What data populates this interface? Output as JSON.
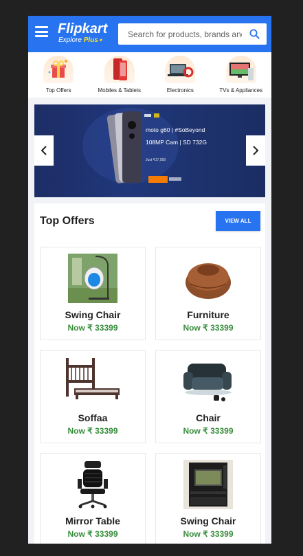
{
  "header": {
    "brand": "Flipkart",
    "tagline_prefix": "Explore",
    "tagline_plus": "Plus",
    "search_placeholder": "Search for products, brands and more"
  },
  "categories": [
    {
      "label": "Top Offers",
      "icon": "gift-icon"
    },
    {
      "label": "Mobiles & Tablets",
      "icon": "phone-icon"
    },
    {
      "label": "Electronics",
      "icon": "laptop-icon"
    },
    {
      "label": "TVs & Appliances",
      "icon": "tv-icon"
    }
  ],
  "banner": {
    "line1": "moto g60 | #SoBeyond",
    "line2": "108MP Cam | SD 732G",
    "line3": "Just ₹17,999"
  },
  "offers": {
    "title": "Top Offers",
    "view_all": "VIEW ALL",
    "products": [
      {
        "name": "Swing Chair",
        "price": "Now ₹ 33399",
        "icon": "swing-chair-icon"
      },
      {
        "name": "Furniture",
        "price": "Now ₹ 33399",
        "icon": "bean-bag-icon"
      },
      {
        "name": "Soffaa",
        "price": "Now ₹ 33399",
        "icon": "bunk-bed-icon"
      },
      {
        "name": "Chair",
        "price": "Now ₹ 33399",
        "icon": "sofa-icon"
      },
      {
        "name": "Mirror Table",
        "price": "Now ₹ 33399",
        "icon": "office-chair-icon"
      },
      {
        "name": "Swing Chair",
        "price": "Now ₹ 33399",
        "icon": "tv-unit-icon"
      }
    ]
  },
  "colors": {
    "brand_blue": "#2874f0",
    "price_green": "#388e3c",
    "logo_yellow": "#ffe11b"
  }
}
